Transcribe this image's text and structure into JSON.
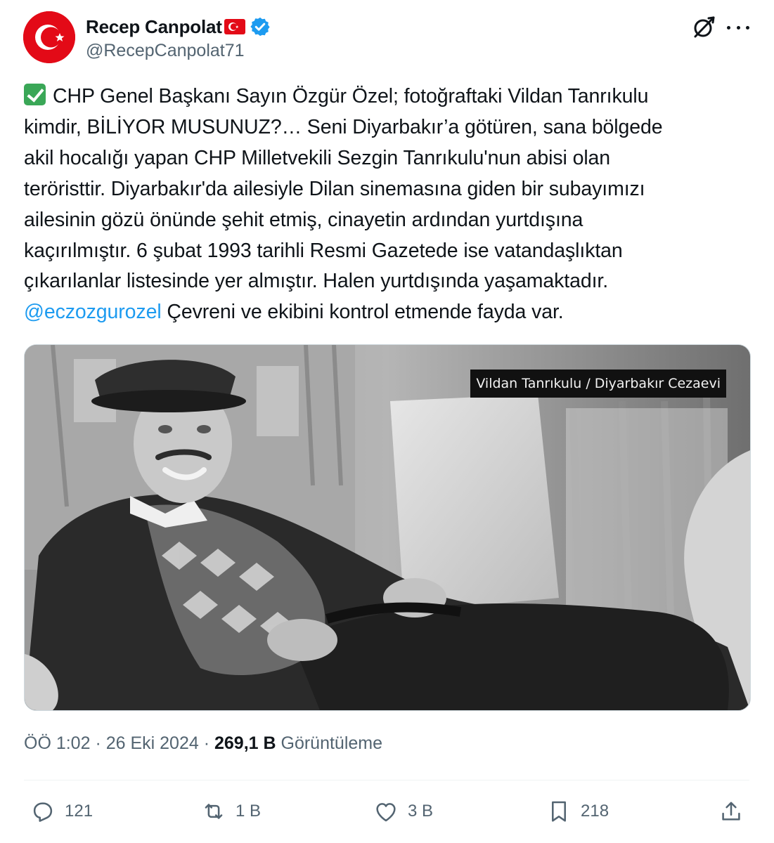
{
  "author": {
    "display_name": "Recep Canpolat",
    "handle": "@RecepCanpolat71",
    "verified": true,
    "name_emoji": "turkey-flag",
    "avatar": "turkish-crescent-star"
  },
  "tweet": {
    "lines": [
      "CHP Genel Başkanı Sayın Özgür Özel; fotoğraftaki Vildan Tanrıkulu",
      "kimdir, BİLİYOR MUSUNUZ?… Seni Diyarbakır’a götüren, sana bölgede",
      "akil hocalığı yapan CHP Milletvekili Sezgin Tanrıkulu'nun abisi olan",
      "teröristtir. Diyarbakır'da ailesiyle Dilan sinemasına giden bir subayımızı",
      "ailesinin gözü önünde şehit etmiş, cinayetin ardından yurtdışına",
      "kaçırılmıştır. 6 şubat 1993 tarihli Resmi Gazetede ise vatandaşlıktan",
      "çıkarılanlar listesinde yer almıştır. Halen yurtdışında yaşamaktadır."
    ],
    "mention": "@eczozgurozel",
    "last_line": " Çevreni ve ekibini kontrol etmende fayda var.",
    "leading_emoji": "check-mark-button"
  },
  "media": {
    "caption": "Vildan Tanrıkulu / Diyarbakır Cezaevi"
  },
  "meta": {
    "time": "ÖÖ 1:02",
    "separator": " · ",
    "date": "26 Eki 2024",
    "views_count": "269,1 B",
    "views_label": " Görüntüleme"
  },
  "actions": {
    "replies": "121",
    "reposts": "1 B",
    "likes": "3 B",
    "bookmarks": "218"
  },
  "colors": {
    "link": "#1d9bf0",
    "verified": "#1d9bf0",
    "secondary_text": "#536471",
    "flag_red": "#e30a17"
  }
}
